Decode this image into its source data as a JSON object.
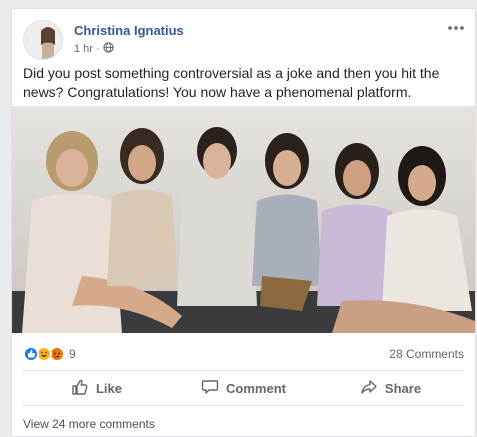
{
  "post": {
    "author": "Christina Ignatius",
    "time": "1 hr",
    "separator": "·",
    "text": "Did you post something controversial as a joke and then you hit the news? Congratulations! You now have a phenomenal platform."
  },
  "icons": {
    "more": "more-options-icon",
    "privacy": "globe-icon",
    "like": "thumbs-up-icon",
    "comment": "speech-bubble-icon",
    "share": "share-arrow-icon"
  },
  "stats": {
    "reaction_count": "9",
    "comments": "28 Comments"
  },
  "actions": {
    "like": "Like",
    "comment": "Comment",
    "share": "Share"
  },
  "footer": {
    "view_more": "View 24 more comments"
  },
  "colors": {
    "link": "#365899",
    "like_reaction": "#1877f2",
    "haha_reaction": "#f7b125",
    "angry_reaction": "#e9710f"
  }
}
